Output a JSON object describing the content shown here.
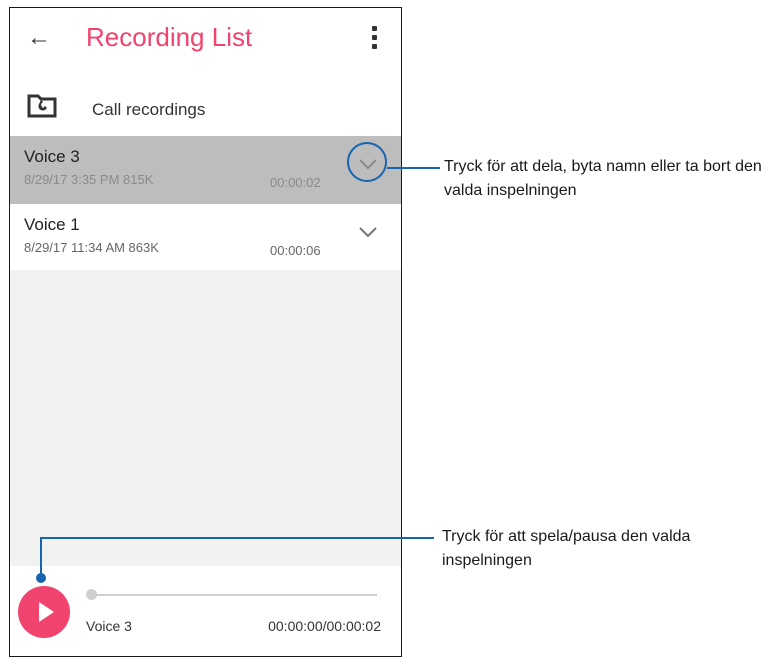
{
  "app": {
    "title": "Recording List"
  },
  "folder": {
    "label": "Call recordings"
  },
  "recordings": [
    {
      "name": "Voice 3",
      "meta": "8/29/17 3:35 PM  815K",
      "duration": "00:00:02"
    },
    {
      "name": "Voice 1",
      "meta": "8/29/17 11:34 AM  863K",
      "duration": "00:00:06"
    }
  ],
  "player": {
    "name": "Voice 3",
    "time": "00:00:00/00:00:02",
    "progress": 0
  },
  "annotations": {
    "top": "Tryck för att dela, byta namn eller ta bort den valda inspelningen",
    "bottom": "Tryck för att spela/pausa den valda inspelningen"
  },
  "colors": {
    "accent": "#f0436d",
    "callout": "#1565b0",
    "selected_row": "#bdbdbd"
  },
  "icons": {
    "back": "arrow-left-icon",
    "menu": "more-vert-icon",
    "folder": "folder-call-icon",
    "expand": "chevron-down-icon",
    "play": "play-icon"
  }
}
